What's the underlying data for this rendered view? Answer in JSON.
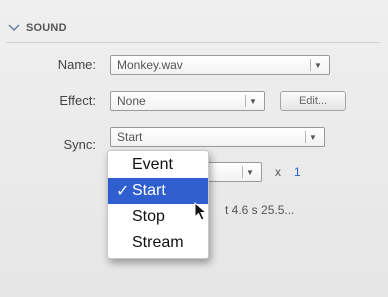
{
  "section": {
    "title": "SOUND",
    "icon": "chevron-down-icon"
  },
  "name_row": {
    "label": "Name:",
    "value": "Monkey.wav"
  },
  "effect_row": {
    "label": "Effect:",
    "value": "None",
    "edit_label": "Edit..."
  },
  "sync_row": {
    "label": "Sync:",
    "value": "Start"
  },
  "repeat_row": {
    "times_symbol": "x",
    "count": "1"
  },
  "info_text": "t 4.6 s 25.5...",
  "dropdown": {
    "items": [
      {
        "label": "Event",
        "checked": ""
      },
      {
        "label": "Start",
        "checked": "✓"
      },
      {
        "label": "Stop",
        "checked": ""
      },
      {
        "label": "Stream",
        "checked": ""
      }
    ],
    "selected_index": 1
  },
  "colors": {
    "selection": "#2f5fcf",
    "link": "#2a63c9",
    "background": "#ececec"
  }
}
